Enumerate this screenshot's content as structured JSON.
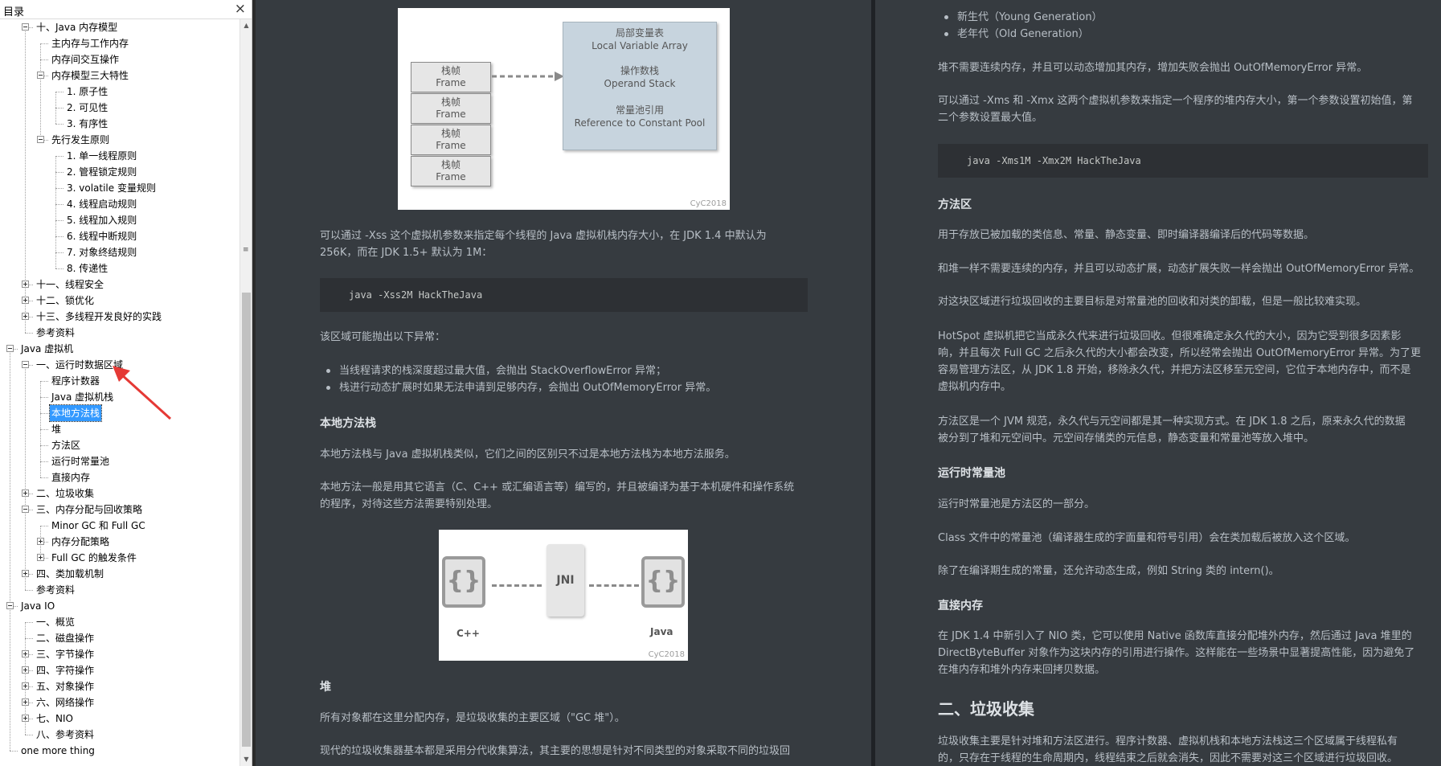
{
  "toc": {
    "title": "目录",
    "close_glyph": "×",
    "items": [
      {
        "label": "十、Java 内存模型",
        "state": "open"
      },
      {
        "label": "主内存与工作内存",
        "state": "leaf"
      },
      {
        "label": "内存间交互操作",
        "state": "leaf"
      },
      {
        "label": "内存模型三大特性",
        "state": "open"
      },
      {
        "label": "1. 原子性",
        "state": "leaf"
      },
      {
        "label": "2. 可见性",
        "state": "leaf"
      },
      {
        "label": "3. 有序性",
        "state": "leaf"
      },
      {
        "label": "先行发生原则",
        "state": "open"
      },
      {
        "label": "1. 单一线程原则",
        "state": "leaf"
      },
      {
        "label": "2. 管程锁定规则",
        "state": "leaf"
      },
      {
        "label": "3. volatile 变量规则",
        "state": "leaf"
      },
      {
        "label": "4. 线程启动规则",
        "state": "leaf"
      },
      {
        "label": "5. 线程加入规则",
        "state": "leaf"
      },
      {
        "label": "6. 线程中断规则",
        "state": "leaf"
      },
      {
        "label": "7. 对象终结规则",
        "state": "leaf"
      },
      {
        "label": "8. 传递性",
        "state": "leaf"
      },
      {
        "label": "十一、线程安全",
        "state": "closed"
      },
      {
        "label": "十二、锁优化",
        "state": "closed"
      },
      {
        "label": "十三、多线程开发良好的实践",
        "state": "closed"
      },
      {
        "label": "参考资料",
        "state": "leaf"
      },
      {
        "label": "Java 虚拟机",
        "state": "open"
      },
      {
        "label": "一、运行时数据区域",
        "state": "open"
      },
      {
        "label": "程序计数器",
        "state": "leaf"
      },
      {
        "label": "Java 虚拟机栈",
        "state": "leaf"
      },
      {
        "label": "本地方法栈",
        "state": "leaf",
        "selected": true
      },
      {
        "label": "堆",
        "state": "leaf"
      },
      {
        "label": "方法区",
        "state": "leaf"
      },
      {
        "label": "运行时常量池",
        "state": "leaf"
      },
      {
        "label": "直接内存",
        "state": "leaf"
      },
      {
        "label": "二、垃圾收集",
        "state": "closed"
      },
      {
        "label": "三、内存分配与回收策略",
        "state": "open"
      },
      {
        "label": "Minor GC 和 Full GC",
        "state": "leaf"
      },
      {
        "label": "内存分配策略",
        "state": "closed"
      },
      {
        "label": "Full GC 的触发条件",
        "state": "closed"
      },
      {
        "label": "四、类加载机制",
        "state": "closed"
      },
      {
        "label": "参考资料",
        "state": "leaf"
      },
      {
        "label": "Java IO",
        "state": "open"
      },
      {
        "label": "一、概览",
        "state": "leaf"
      },
      {
        "label": "二、磁盘操作",
        "state": "leaf"
      },
      {
        "label": "三、字节操作",
        "state": "closed"
      },
      {
        "label": "四、字符操作",
        "state": "closed"
      },
      {
        "label": "五、对象操作",
        "state": "closed"
      },
      {
        "label": "六、网络操作",
        "state": "closed"
      },
      {
        "label": "七、NIO",
        "state": "closed"
      },
      {
        "label": "八、参考资料",
        "state": "leaf"
      },
      {
        "label": "one more thing",
        "state": "leaf"
      }
    ]
  },
  "left_pane": {
    "fig_stack": {
      "frame_zh": "栈帧",
      "frame_en": "Frame",
      "lva_zh": "局部变量表",
      "lva_en": "Local Variable Array",
      "os_zh": "操作数栈",
      "os_en": "Operand Stack",
      "cp_zh": "常量池引用",
      "cp_en": "Reference to Constant Pool",
      "watermark": "CyC2018"
    },
    "p_xss_1": "可以通过 -Xss 这个虚拟机参数来指定每个线程的 Java 虚拟机栈内存大小，在 JDK 1.4 中默认为",
    "p_xss_2": "256K，而在 JDK 1.5+ 默认为 1M：",
    "code_xss": "java -Xss2M HackTheJava",
    "p_exceptions": "该区域可能抛出以下异常：",
    "bullet_1": "当线程请求的栈深度超过最大值，会抛出 StackOverflowError 异常；",
    "bullet_2": "栈进行动态扩展时如果无法申请到足够内存，会抛出 OutOfMemoryError 异常。",
    "h_native": "本地方法栈",
    "p_native_1": "本地方法栈与 Java 虚拟机栈类似，它们之间的区别只不过是本地方法栈为本地方法服务。",
    "p_native_2a": "本地方法一般是用其它语言（C、C++ 或汇编语言等）编写的，并且被编译为基于本机硬件和操作系统",
    "p_native_2b": "的程序，对待这些方法需要特别处理。",
    "fig_jni": {
      "left_label": "C++",
      "center_label": "JNI",
      "right_label": "Java",
      "brace_glyph": "{}",
      "watermark": "CyC2018"
    },
    "h_heap": "堆",
    "p_heap_1": "所有对象都在这里分配内存，是垃圾收集的主要区域（\"GC 堆\"）。",
    "p_heap_2": "现代的垃圾收集器基本都是采用分代收集算法，其主要的思想是针对不同类型的对象采取不同的垃圾回"
  },
  "right_pane": {
    "bullet_young": "新生代（Young Generation）",
    "bullet_old": "老年代（Old Generation）",
    "p_heap_grow": "堆不需要连续内存，并且可以动态增加其内存，增加失败会抛出 OutOfMemoryError 异常。",
    "p_xms_1": "可以通过 -Xms 和 -Xmx 这两个虚拟机参数来指定一个程序的堆内存大小，第一个参数设置初始值，第",
    "p_xms_2": "二个参数设置最大值。",
    "code_xms": "java -Xms1M -Xmx2M HackTheJava",
    "h_method": "方法区",
    "p_method_1": "用于存放已被加载的类信息、常量、静态变量、即时编译器编译后的代码等数据。",
    "p_method_2": "和堆一样不需要连续的内存，并且可以动态扩展，动态扩展失败一样会抛出 OutOfMemoryError 异常。",
    "p_method_3": "对这块区域进行垃圾回收的主要目标是对常量池的回收和对类的卸载，但是一般比较难实现。",
    "p_hotspot_1": "HotSpot 虚拟机把它当成永久代来进行垃圾回收。但很难确定永久代的大小，因为它受到很多因素影",
    "p_hotspot_2": "响，并且每次 Full GC 之后永久代的大小都会改变，所以经常会抛出 OutOfMemoryError 异常。为了更",
    "p_hotspot_3": "容易管理方法区，从 JDK 1.8 开始，移除永久代，并把方法区移至元空间，它位于本地内存中，而不是",
    "p_hotspot_4": "虚拟机内存中。",
    "p_jvm_1": "方法区是一个 JVM 规范，永久代与元空间都是其一种实现方式。在 JDK 1.8 之后，原来永久代的数据",
    "p_jvm_2": "被分到了堆和元空间中。元空间存储类的元信息，静态变量和常量池等放入堆中。",
    "h_rcp": "运行时常量池",
    "p_rcp_1": "运行时常量池是方法区的一部分。",
    "p_rcp_2": "Class 文件中的常量池（编译器生成的字面量和符号引用）会在类加载后被放入这个区域。",
    "p_rcp_3": "除了在编译期生成的常量，还允许动态生成，例如 String 类的 intern()。",
    "h_direct": "直接内存",
    "p_direct_1": "在 JDK 1.4 中新引入了 NIO 类，它可以使用 Native 函数库直接分配堆外内存，然后通过 Java 堆里的",
    "p_direct_2": "DirectByteBuffer 对象作为这块内存的引用进行操作。这样能在一些场景中显著提高性能，因为避免了",
    "p_direct_3": "在堆内存和堆外内存来回拷贝数据。",
    "h2_gc": "二、垃圾收集",
    "p_gc_1": "垃圾收集主要是针对堆和方法区进行。程序计数器、虚拟机栈和本地方法栈这三个区域属于线程私有",
    "p_gc_2": "的，只存在于线程的生命周期内，线程结束之后就会消失，因此不需要对这三个区域进行垃圾回收。"
  },
  "colors": {
    "sidebar_bg": "#ffffff",
    "selection": "#3399ff",
    "pane_bg": "#363b40",
    "code_bg": "#2d3034",
    "text": "#b8bfc6",
    "heading": "#dde1e5",
    "arrow": "#e53935"
  },
  "icons": {
    "close": "close-icon",
    "expand": "expand-toggle-icon",
    "arrow": "red-arrow-annotation-icon"
  }
}
